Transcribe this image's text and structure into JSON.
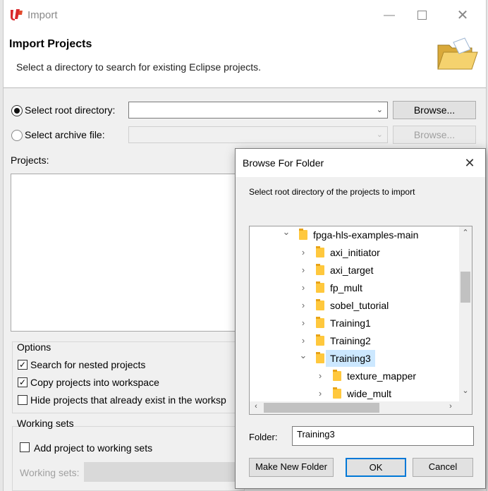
{
  "window": {
    "title": "Import",
    "header_title": "Import Projects",
    "header_desc": "Select a directory to search for existing Eclipse projects."
  },
  "source": {
    "root_label": "Select root directory:",
    "root_value": "",
    "archive_label": "Select archive file:",
    "browse_label": "Browse...",
    "browse2_label": "Browse..."
  },
  "projects_label": "Projects:",
  "options": {
    "title": "Options",
    "nested": "Search for nested projects",
    "copy": "Copy projects into workspace",
    "hide": "Hide projects that already exist in the worksp"
  },
  "working_sets": {
    "title": "Working sets",
    "add_label": "Add project to working sets",
    "sets_label": "Working sets:"
  },
  "dialog": {
    "title": "Browse For Folder",
    "instruction": "Select root directory of the projects to import",
    "tree": [
      {
        "label": "fpga-hls-examples-main",
        "state": "expanded",
        "selected": false
      },
      {
        "label": "axi_initiator",
        "state": "collapsed",
        "selected": false
      },
      {
        "label": "axi_target",
        "state": "collapsed",
        "selected": false
      },
      {
        "label": "fp_mult",
        "state": "collapsed",
        "selected": false
      },
      {
        "label": "sobel_tutorial",
        "state": "collapsed",
        "selected": false
      },
      {
        "label": "Training1",
        "state": "collapsed",
        "selected": false
      },
      {
        "label": "Training2",
        "state": "collapsed",
        "selected": false
      },
      {
        "label": "Training3",
        "state": "expanded",
        "selected": true
      },
      {
        "label": "texture_mapper",
        "state": "collapsed",
        "selected": false
      },
      {
        "label": "wide_mult",
        "state": "collapsed",
        "selected": false
      }
    ],
    "folder_label": "Folder:",
    "folder_value": "Training3",
    "make_new_folder": "Make New Folder",
    "ok": "OK",
    "cancel": "Cancel"
  },
  "colors": {
    "selection": "#cce8ff",
    "folder": "#ffc83d",
    "ok_border": "#0078d7"
  }
}
